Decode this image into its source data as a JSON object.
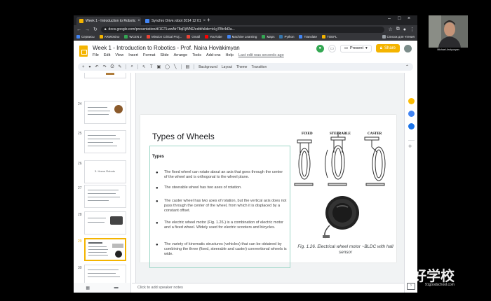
{
  "tabs": [
    {
      "label": "Week 1 - Introduction to Robotic",
      "active": true,
      "favicon_color": "#f4b400"
    },
    {
      "label": "Synchro Drive.robot 2014 12 01",
      "active": false,
      "favicon_color": "#4285f4"
    }
  ],
  "address": "docs.google.com/presentation/d/1GTLwwNr78qRjWNE/edit#slide=id.g78fc4d3a...",
  "bookmarks": [
    {
      "label": "Сервисы",
      "color": "#4285f4"
    },
    {
      "label": "ARMOsino",
      "color": "#f4b400"
    },
    {
      "label": "WCEN 2",
      "color": "#34a853"
    },
    {
      "label": "Mission Critical Proj...",
      "color": "#ea4335"
    },
    {
      "label": "Gmail",
      "color": "#ea4335"
    },
    {
      "label": "YouTube",
      "color": "#ff0000"
    },
    {
      "label": "Machine Learning",
      "color": "#4285f4"
    },
    {
      "label": "Maps",
      "color": "#34a853"
    },
    {
      "label": "Python",
      "color": "#3776ab"
    },
    {
      "label": "Translate",
      "color": "#4285f4"
    },
    {
      "label": "TOEFL",
      "color": "#f4b400"
    },
    {
      "label": "Список для чтения",
      "color": "#9aa0a6"
    }
  ],
  "doc": {
    "title": "Week 1 - Introduction to Robotics - Prof. Naira Hovakimyan",
    "menus": [
      "File",
      "Edit",
      "View",
      "Insert",
      "Format",
      "Slide",
      "Arrange",
      "Tools",
      "Add-ons",
      "Help"
    ],
    "last_edit": "Last edit was seconds ago",
    "present_label": "Present",
    "share_label": "Share"
  },
  "toolbar": {
    "background": "Background",
    "layout": "Layout",
    "theme": "Theme",
    "transition": "Transition"
  },
  "filmstrip": {
    "slide_numbers": [
      "24",
      "25",
      "26",
      "27",
      "28",
      "29",
      "30"
    ],
    "slide_26_text": "3. Home Robots",
    "selected": "28"
  },
  "slide": {
    "title": "Types of Wheels",
    "types_heading": "Types",
    "bullets": [
      "The fixed wheel can rotate about an axis that goes through the center of the wheel and is orthogonal to the wheel plane.",
      "The steerable wheel has two axes of rotation.",
      "The caster wheel has two axes of rotation, but the vertical axis does not pass through the center of the wheel, from which it is displaced by a constant offset.",
      "The electric wheel motor (Fig. 1.26.) is a combination of electric motor and a fixed wheel. Widely used for electric scooters and bicycles.",
      "The variety of kinematic structures (vehicles) that can be obtained by combining the three (fixed, steerable and caster) conventional wheels is wide."
    ],
    "wheel_labels": [
      "FIXED",
      "STEERABLE",
      "CASTER"
    ],
    "caption": "Fig. 1.26. Electrical wheel motor ~BLDC with hall sensor"
  },
  "speaker_notes_placeholder": "Click to add speaker notes",
  "webcam_name": "Michael Arutyunyan",
  "watermark": {
    "text": "好学校",
    "url": "91goodschool.com"
  }
}
